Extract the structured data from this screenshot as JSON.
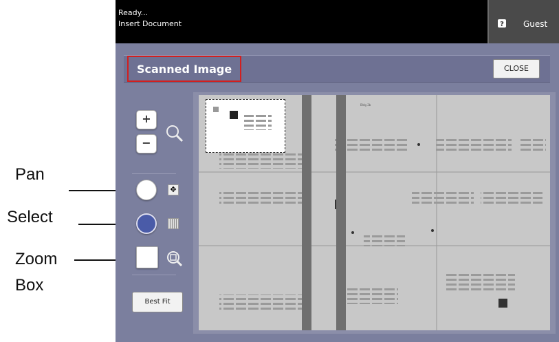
{
  "annotations": {
    "pan": "Pan",
    "select": "Select",
    "zoom_box": "Zoom Box"
  },
  "status": {
    "line1": "Ready...",
    "line2": "Insert Document"
  },
  "user": {
    "label": "Guest"
  },
  "window": {
    "title": "Scanned Image",
    "close_label": "CLOSE"
  },
  "tools": {
    "zoom_in": "+",
    "zoom_out": "−",
    "best_fit": "Best Fit",
    "selected_mode": "select"
  },
  "colors": {
    "highlight": "#d21f1f",
    "select_active": "#4a5ba8"
  }
}
